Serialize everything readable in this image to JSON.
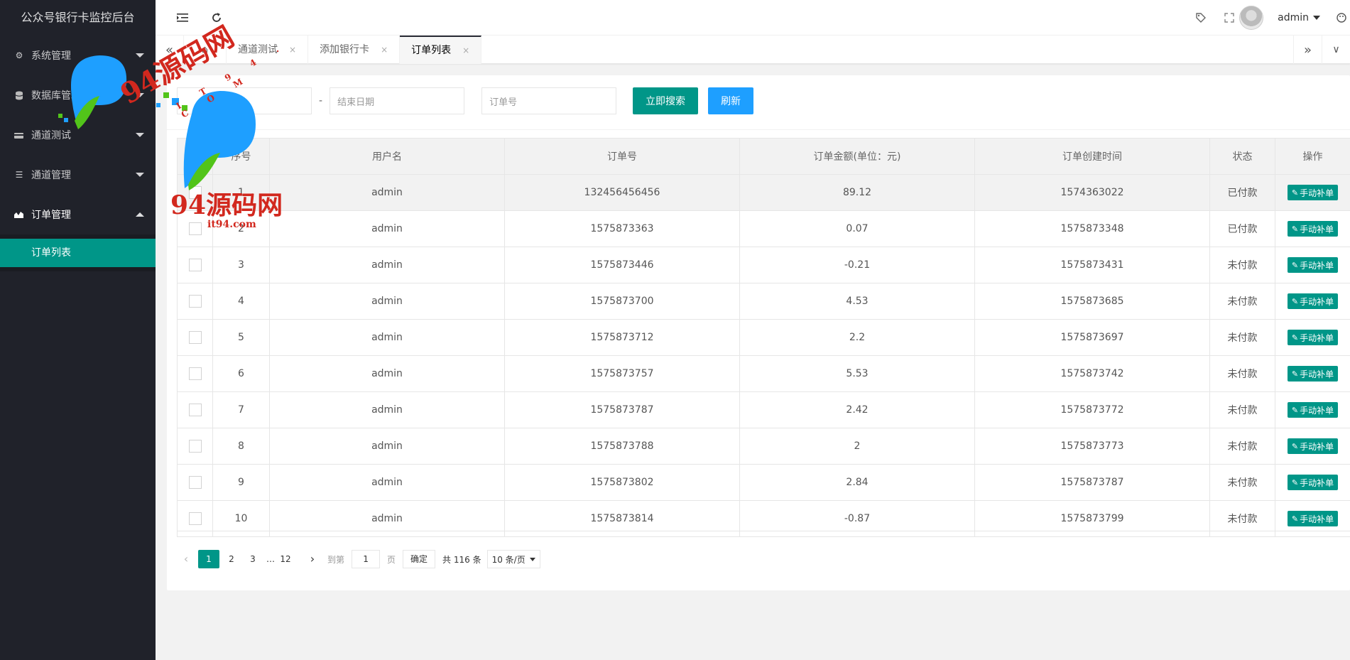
{
  "sidebar": {
    "title": "公众号银行卡监控后台",
    "items": [
      {
        "label": "系统管理",
        "icon": "gear-icon"
      },
      {
        "label": "数据库管理",
        "icon": "database-icon"
      },
      {
        "label": "通道测试",
        "icon": "card-icon"
      },
      {
        "label": "通道管理",
        "icon": "list-icon"
      },
      {
        "label": "订单管理",
        "icon": "chart-icon"
      }
    ],
    "subitem": "订单列表"
  },
  "header": {
    "username": "admin"
  },
  "tabs": {
    "items": [
      {
        "label": "通道测试"
      },
      {
        "label": "添加银行卡"
      },
      {
        "label": "订单列表"
      }
    ],
    "close": "×"
  },
  "search": {
    "end_date_placeholder": "结束日期",
    "order_placeholder": "订单号",
    "dash": "-",
    "search_button": "立即搜索",
    "refresh_button": "刷新"
  },
  "table": {
    "headers": [
      "序号",
      "用户名",
      "订单号",
      "订单金额(单位：元)",
      "订单创建时间",
      "状态",
      "操作"
    ],
    "op_label": "手动补单",
    "rows": [
      {
        "no": "1",
        "user": "admin",
        "order": "132456456456",
        "amount": "89.12",
        "time": "1574363022",
        "status": "已付款"
      },
      {
        "no": "2",
        "user": "admin",
        "order": "1575873363",
        "amount": "0.07",
        "time": "1575873348",
        "status": "已付款"
      },
      {
        "no": "3",
        "user": "admin",
        "order": "1575873446",
        "amount": "-0.21",
        "time": "1575873431",
        "status": "未付款"
      },
      {
        "no": "4",
        "user": "admin",
        "order": "1575873700",
        "amount": "4.53",
        "time": "1575873685",
        "status": "未付款"
      },
      {
        "no": "5",
        "user": "admin",
        "order": "1575873712",
        "amount": "2.2",
        "time": "1575873697",
        "status": "未付款"
      },
      {
        "no": "6",
        "user": "admin",
        "order": "1575873757",
        "amount": "5.53",
        "time": "1575873742",
        "status": "未付款"
      },
      {
        "no": "7",
        "user": "admin",
        "order": "1575873787",
        "amount": "2.42",
        "time": "1575873772",
        "status": "未付款"
      },
      {
        "no": "8",
        "user": "admin",
        "order": "1575873788",
        "amount": "2",
        "time": "1575873773",
        "status": "未付款"
      },
      {
        "no": "9",
        "user": "admin",
        "order": "1575873802",
        "amount": "2.84",
        "time": "1575873787",
        "status": "未付款"
      },
      {
        "no": "10",
        "user": "admin",
        "order": "1575873814",
        "amount": "-0.87",
        "time": "1575873799",
        "status": "未付款"
      }
    ]
  },
  "pager": {
    "pages": [
      "1",
      "2",
      "3"
    ],
    "ellipsis": "…",
    "last": "12",
    "goto_label": "到第",
    "goto_value": "1",
    "page_unit": "页",
    "confirm": "确定",
    "total": "共 116 条",
    "page_size": "10 条/页"
  },
  "watermark": {
    "main": "94源码网",
    "url": "it94.com",
    "dots": "I T 9 4 . C O M"
  },
  "colors": {
    "sidebar_bg": "#20222a",
    "accent": "#009688",
    "blue": "#1e9fff"
  }
}
